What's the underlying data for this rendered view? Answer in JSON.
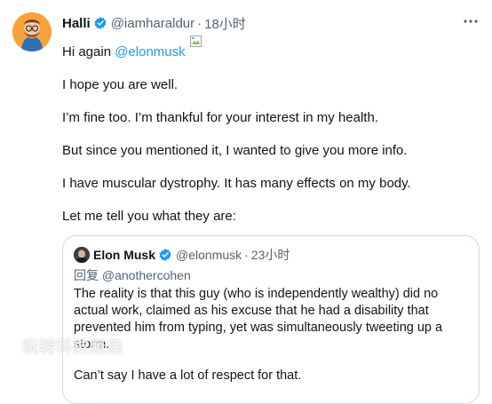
{
  "tweet": {
    "author_name": "Halli",
    "author_handle": "@iamharaldur",
    "separator": "·",
    "timestamp": "18小时",
    "greeting_prefix": "Hi again ",
    "mention": "@elonmusk",
    "paragraphs": [
      "I hope you are well.",
      "I’m fine too. I’m thankful for your interest in my health.",
      "But since you mentioned it, I wanted to give you more info.",
      "I have muscular dystrophy. It has many effects on my body.",
      "Let me tell you what they are:"
    ],
    "verified_icon": "verified-badge-icon",
    "more_icon": "more-options-icon"
  },
  "quote": {
    "author_name": "Elon Musk",
    "author_handle": "@elonmusk",
    "separator": "·",
    "timestamp": "23小时",
    "reply_to": "回复 @anothercohen",
    "lines": [
      "The reality is that this guy (who is independently wealthy) did no",
      "actual work, claimed as his excuse that he had a disability that",
      "prevented him from typing, yet was simultaneously tweeting up a",
      "storm."
    ],
    "last_line": "Can’t say I have a lot of respect for that."
  },
  "watermark": "玩转科技聚集",
  "colors": {
    "link": "#1d9bf0",
    "secondary_text": "#536471",
    "border": "#cfd9de"
  }
}
